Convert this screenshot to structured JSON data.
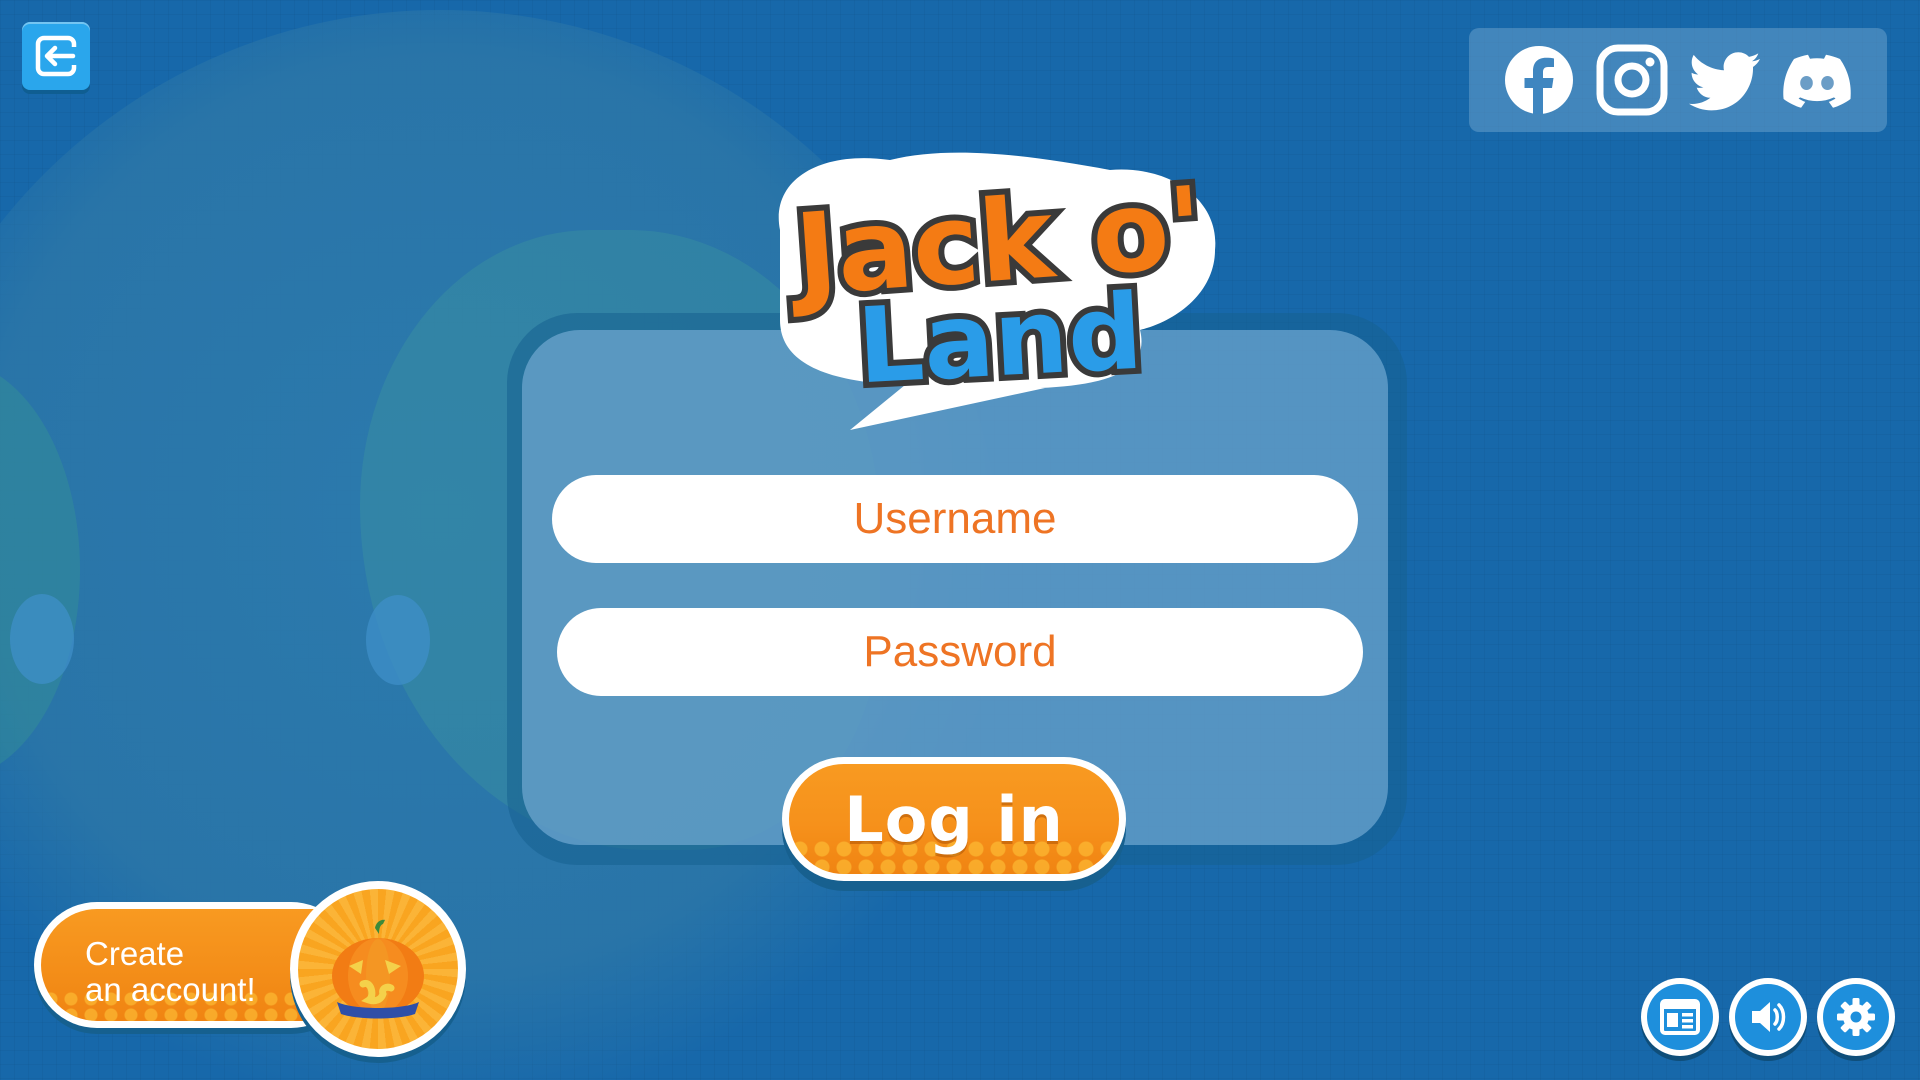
{
  "game": {
    "title_line1": "Jack o'",
    "title_line2": "Land"
  },
  "header": {
    "exit_icon": "exit-arrow-icon",
    "social": [
      {
        "name": "facebook",
        "icon": "facebook-icon"
      },
      {
        "name": "instagram",
        "icon": "instagram-icon"
      },
      {
        "name": "twitter",
        "icon": "twitter-icon"
      },
      {
        "name": "discord",
        "icon": "discord-icon"
      }
    ]
  },
  "login_form": {
    "username_placeholder": "Username",
    "password_placeholder": "Password",
    "username_value": "",
    "password_value": "",
    "submit_label": "Log in"
  },
  "create_account": {
    "label_line1": "Create",
    "label_line2": "an account!",
    "icon": "pumpkin-icon"
  },
  "footer_buttons": [
    {
      "name": "news",
      "icon": "newspaper-icon"
    },
    {
      "name": "sound",
      "icon": "speaker-icon"
    },
    {
      "name": "settings",
      "icon": "gear-icon"
    }
  ],
  "colors": {
    "background": "#1768aa",
    "accent_orange": "#f6911b",
    "accent_blue": "#1e8fdc",
    "input_text": "#ee7424",
    "logo_orange": "#f47b14",
    "logo_blue": "#2a9ce8"
  }
}
